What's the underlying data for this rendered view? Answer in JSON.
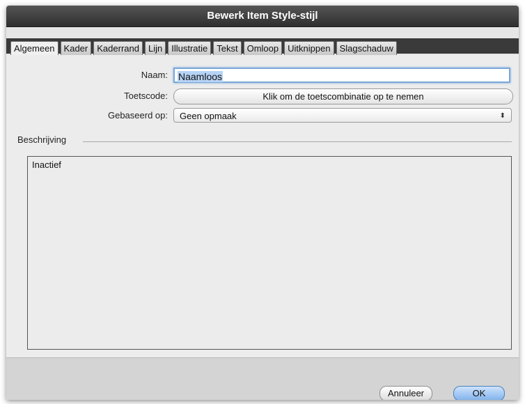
{
  "window": {
    "title": "Bewerk Item Style-stijl"
  },
  "tabs": [
    {
      "label": "Algemeen",
      "active": true
    },
    {
      "label": "Kader",
      "active": false
    },
    {
      "label": "Kaderrand",
      "active": false
    },
    {
      "label": "Lijn",
      "active": false
    },
    {
      "label": "Illustratie",
      "active": false
    },
    {
      "label": "Tekst",
      "active": false
    },
    {
      "label": "Omloop",
      "active": false
    },
    {
      "label": "Uitknippen",
      "active": false
    },
    {
      "label": "Slagschaduw",
      "active": false
    }
  ],
  "form": {
    "name_label": "Naam:",
    "name_value": "Naamloos",
    "key_label": "Toetscode:",
    "key_button": "Klik om de toetscombinatie op te nemen",
    "based_label": "Gebaseerd op:",
    "based_value": "Geen opmaak",
    "based_arrows": "⬍"
  },
  "description": {
    "label": "Beschrijving",
    "text": "Inactief"
  },
  "buttons": {
    "cancel": "Annuleer",
    "ok": "OK"
  }
}
